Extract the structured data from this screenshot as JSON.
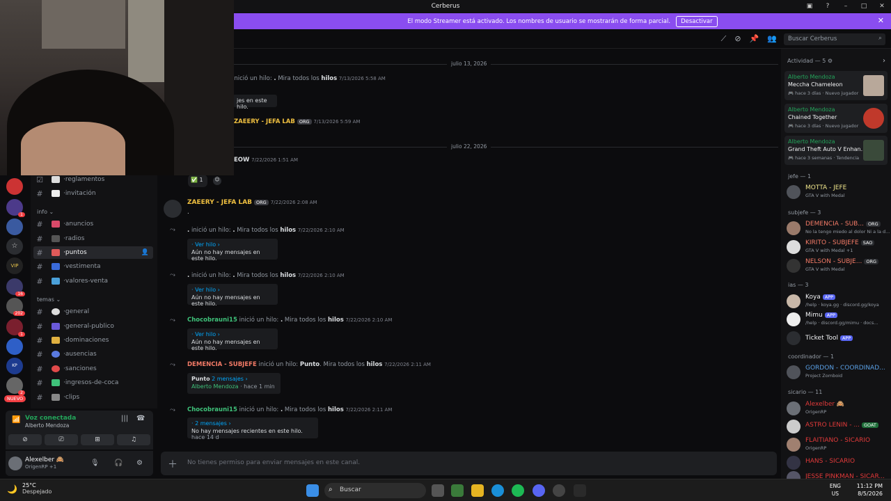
{
  "window": {
    "title": "Cerberus"
  },
  "banner": {
    "text": "El modo Streamer está activado. Los nombres de usuario se mostrarán de forma parcial.",
    "button": "Desactivar"
  },
  "header": {
    "search_placeholder": "Buscar Cerberus"
  },
  "servers": {
    "badges": [
      "1",
      "16",
      "202",
      "1",
      "2"
    ],
    "labels": [
      "VIP",
      "KP"
    ],
    "new_badge": "NUEVO"
  },
  "channels": {
    "categories": {
      "info": "info ⌄",
      "temas": "temas ⌄"
    },
    "items": [
      {
        "label": "reglamentos"
      },
      {
        "label": "invitación"
      },
      {
        "label": "anuncios"
      },
      {
        "label": "radios"
      },
      {
        "label": "puntos"
      },
      {
        "label": "vestimenta"
      },
      {
        "label": "valores-venta"
      },
      {
        "label": "general"
      },
      {
        "label": "general-publico"
      },
      {
        "label": "dominaciones"
      },
      {
        "label": "ausencias"
      },
      {
        "label": "sanciones"
      },
      {
        "label": "ingresos-de-coca"
      },
      {
        "label": "clips"
      }
    ]
  },
  "voice": {
    "title": "Voz conectada",
    "subtitle": "Alberto Mendoza"
  },
  "user": {
    "name": "Alexelber 🙈",
    "status": "OrigenRP +1"
  },
  "messages": {
    "date1": "julio 13, 2026",
    "date2": "julio 22, 2026",
    "m1_text": "inició un hilo:",
    "m1_name": ".",
    "m1_see": "Mira todos los",
    "m1_hilos": "hilos",
    "m1_ts": "7/13/2026 5:58 AM",
    "m1_box": "jes en este hilo.",
    "m2_name": "ZAEERY - JEFA LAB",
    "m2_tag": "ORG",
    "m2_ts": "7/13/2026 5:59 AM",
    "m3_name": "EOW",
    "m3_ts": "7/22/2026 1:51 AM",
    "m3_reaction": "1",
    "m4_name": "ZAEERY - JEFA LAB",
    "m4_tag": "ORG",
    "m4_ts": "7/22/2026 2:08 AM",
    "m4_body": ".",
    "t1_author": ".",
    "t1_text": "inició un hilo:",
    "t1_thread": ".",
    "t1_see": "Mira todos los",
    "t1_hilos": "hilos",
    "t1_ts": "7/22/2026 2:10 AM",
    "t1_link": "Ver hilo ›",
    "t1_box": "Aún no hay mensajes en este hilo.",
    "t2_author": ".",
    "t2_text": "inició un hilo:",
    "t2_thread": ".",
    "t2_see": "Mira todos los",
    "t2_hilos": "hilos",
    "t2_ts": "7/22/2026 2:10 AM",
    "t2_link": "Ver hilo ›",
    "t2_box": "Aún no hay mensajes en este hilo.",
    "t3_author": "Chocobrauni15",
    "t3_text": "inició un hilo:",
    "t3_thread": ".",
    "t3_see": "Mira todos los",
    "t3_hilos": "hilos",
    "t3_ts": "7/22/2026 2:10 AM",
    "t3_link": "Ver hilo ›",
    "t3_box": "Aún no hay mensajes en este hilo.",
    "t4_author": "DEMENCIA - SUBJEFE",
    "t4_text": "inició un hilo:",
    "t4_thread": "Punto",
    "t4_see": "Mira todos los",
    "t4_hilos": "hilos",
    "t4_ts": "7/22/2026 2:11 AM",
    "t4_box_title": "Punto",
    "t4_box_count": "2 mensajes ›",
    "t4_box_user": "Alberto Mendoza",
    "t4_box_time": "hace 1 min",
    "t5_author": "Chocobrauni15",
    "t5_text": "inició un hilo:",
    "t5_thread": ".",
    "t5_see": "Mira todos los",
    "t5_hilos": "hilos",
    "t5_ts": "7/22/2026 2:11 AM",
    "t5_box_count": "2 mensajes ›",
    "t5_box": "No hay mensajes recientes en este hilo.",
    "t5_box_time": "hace 14 d"
  },
  "composer": {
    "placeholder": "No tienes permiso para enviar mensajes en este canal."
  },
  "activity": {
    "title": "Actividad — 5",
    "items": [
      {
        "user": "Alberto Mendoza",
        "game": "Meccha Chameleon",
        "meta": "hace 3 días",
        "tag": "Nuevo jugador"
      },
      {
        "user": "Alberto Mendoza",
        "game": "Chained Together",
        "meta": "hace 3 días",
        "tag": "Nuevo jugador"
      },
      {
        "user": "Alberto Mendoza",
        "game": "Grand Theft Auto V Enhan...",
        "meta": "hace 3 semanas",
        "tag": "Tendencia"
      }
    ]
  },
  "members": {
    "groups": [
      "jefe — 1",
      "subjefe — 3",
      "ias — 3",
      "coordinador — 1",
      "sicario — 11"
    ],
    "list": [
      {
        "name": "MOTTA - JEFE",
        "status": "GTA V with Medal",
        "tag": "",
        "color": "#f0e68c"
      },
      {
        "name": "DEMENCIA - SUB...",
        "status": "No la tengo miedo al dolor Ni a la d...",
        "tag": "ORG",
        "color": "#f47b67"
      },
      {
        "name": "KIRITO - SUBJEFE",
        "status": "GTA V with Medal +1",
        "tag": "SAO",
        "color": "#f47b67"
      },
      {
        "name": "NELSON - SUBJE...",
        "status": "GTA V with Medal",
        "tag": "ORG",
        "color": "#f47b67"
      },
      {
        "name": "Koya",
        "status": "/help · koya.gg · discord.gg/koya",
        "tag": "APP",
        "color": "#f2f3f5"
      },
      {
        "name": "Mimu",
        "status": "/help · discord.gg/mimu · docs...",
        "tag": "APP",
        "color": "#f2f3f5"
      },
      {
        "name": "Ticket Tool",
        "status": "",
        "tag": "APP",
        "color": "#f2f3f5"
      },
      {
        "name": "GORDON - COORDINAD...",
        "status": "Project Zomboid",
        "tag": "",
        "color": "#5aa0e6"
      },
      {
        "name": "Alexelber 🙈",
        "status": "OrigenRP",
        "tag": "",
        "color": "#e23a3a"
      },
      {
        "name": "ASTRO LENIN - ...",
        "status": "",
        "tag": "GOAT",
        "color": "#e23a3a"
      },
      {
        "name": "FLAITIANO - SICARIO",
        "status": "OrigenRP",
        "tag": "",
        "color": "#e23a3a"
      },
      {
        "name": "HANS - SICARIO",
        "status": "",
        "tag": "",
        "color": "#e23a3a"
      },
      {
        "name": "JESSE PINKMAN - SICAR...",
        "status": "",
        "tag": "",
        "color": "#e23a3a"
      }
    ]
  },
  "taskbar": {
    "temp": "25°C",
    "weather": "Despejado",
    "search": "Buscar",
    "lang1": "ENG",
    "lang2": "US",
    "time": "11:12 PM",
    "date": "8/5/2026"
  }
}
